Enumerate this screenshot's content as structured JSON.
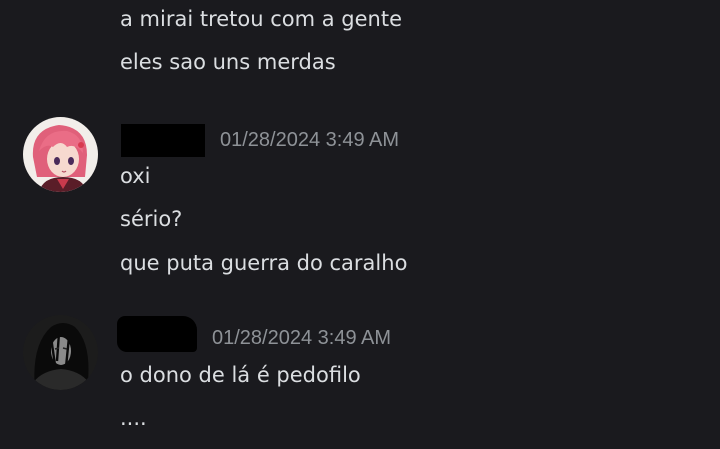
{
  "messages": [
    {
      "author_avatar": "none",
      "lines": [
        "a mirai tretou com a gente",
        "eles sao uns merdas"
      ]
    },
    {
      "author_avatar": "pink-haired-anime-girl-avatar",
      "username_redacted": true,
      "timestamp": "01/28/2024 3:49 AM",
      "lines": [
        "oxi",
        "sério?",
        "que puta guerra do caralho"
      ]
    },
    {
      "author_avatar": "dark-long-haired-figure-avatar",
      "username_redacted": true,
      "timestamp": "01/28/2024 3:49 AM",
      "lines": [
        "o dono de lá é pedofilo",
        "...."
      ]
    }
  ],
  "colors": {
    "background": "#1a1a1e",
    "message_text": "#dbdee1",
    "timestamp_text": "#8e9297",
    "redaction": "#000000"
  }
}
